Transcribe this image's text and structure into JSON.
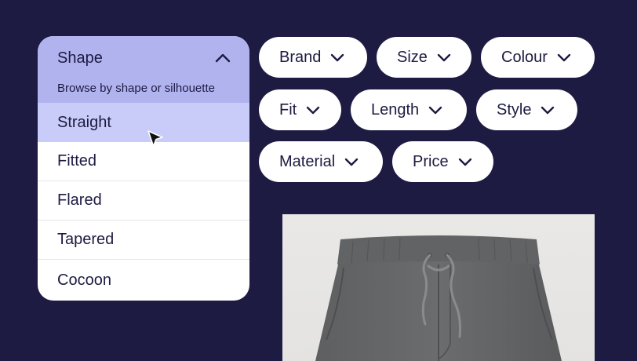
{
  "dropdown": {
    "title": "Shape",
    "subtitle": "Browse by shape or silhouette",
    "options": [
      "Straight",
      "Fitted",
      "Flared",
      "Tapered",
      "Cocoon"
    ],
    "selected": "Straight",
    "expanded": true
  },
  "filters": [
    "Brand",
    "Size",
    "Colour",
    "Fit",
    "Length",
    "Style",
    "Material",
    "Price"
  ],
  "product_image": {
    "subject": "grey drawstring trousers"
  },
  "icons": {
    "caret": "chevron-up-icon",
    "filter_chevron": "chevron-down-icon",
    "pointer": "mouse-pointer-icon"
  },
  "colors": {
    "background": "#1d1b42",
    "dropdown_header": "#b1b3ef",
    "selected_option": "#c9ccf8",
    "text": "#1d1b42",
    "pill": "#ffffff"
  }
}
